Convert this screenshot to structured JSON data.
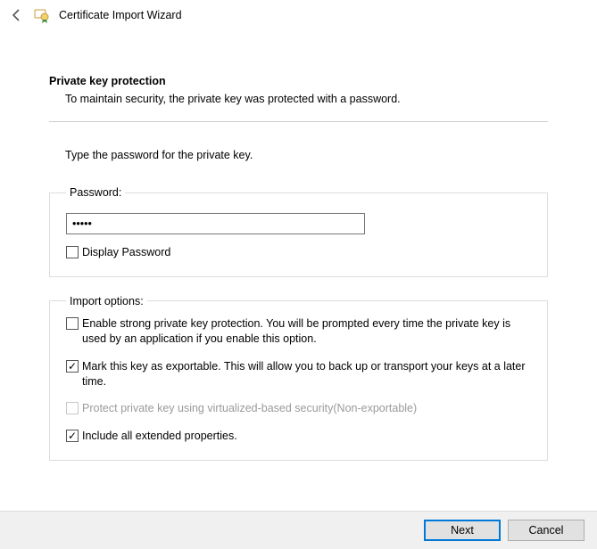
{
  "title": "Certificate Import Wizard",
  "section": {
    "heading": "Private key protection",
    "description": "To maintain security, the private key was protected with a password."
  },
  "instruction": "Type the password for the private key.",
  "password_group": {
    "legend": "Password:",
    "value": "•••••",
    "display_password_label": "Display Password",
    "display_password_checked": false
  },
  "import_options": {
    "legend": "Import options:",
    "items": [
      {
        "label": "Enable strong private key protection. You will be prompted every time the private key is used by an application if you enable this option.",
        "checked": false,
        "disabled": false
      },
      {
        "label": "Mark this key as exportable. This will allow you to back up or transport your keys at a later time.",
        "checked": true,
        "disabled": false
      },
      {
        "label": "Protect private key using virtualized-based security(Non-exportable)",
        "checked": false,
        "disabled": true
      },
      {
        "label": "Include all extended properties.",
        "checked": true,
        "disabled": false
      }
    ]
  },
  "buttons": {
    "next": "Next",
    "cancel": "Cancel"
  }
}
